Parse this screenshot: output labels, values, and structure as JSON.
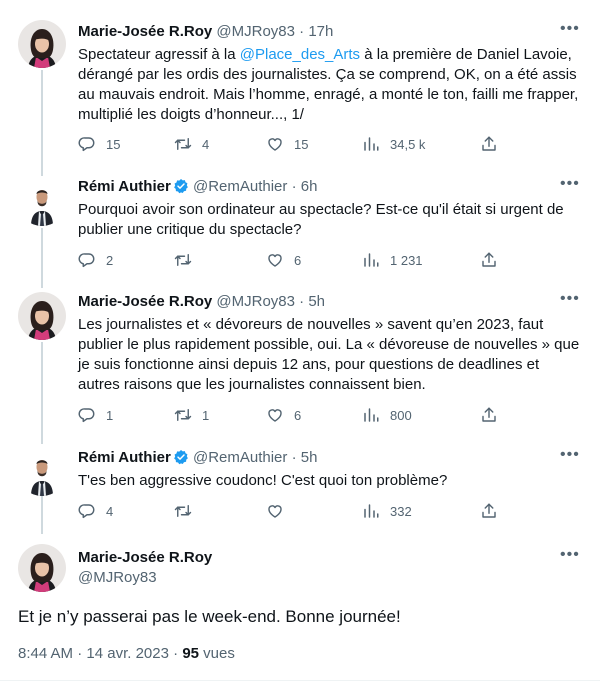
{
  "tweets": [
    {
      "name": "Marie-Josée R.Roy",
      "handle": "@MJRoy83",
      "time": "17h",
      "text_before": "Spectateur agressif à la ",
      "mention": "@Place_des_Arts",
      "text_after": " à la première de Daniel Lavoie, dérangé par les ordis des journalistes. Ça se comprend, OK, on a été assis au mauvais endroit. Mais l’homme, enragé, a monté le ton, failli me frapper, multiplié les doigts d’honneur..., 1/",
      "replies": "15",
      "retweets": "4",
      "likes": "15",
      "views": "34,5 k"
    },
    {
      "name": "Rémi Authier",
      "handle": "@RemAuthier",
      "time": "6h",
      "text": "Pourquoi avoir son ordinateur au spectacle? Est-ce qu'il était si urgent de publier une critique du spectacle?",
      "replies": "2",
      "retweets": "",
      "likes": "6",
      "views": "1 231"
    },
    {
      "name": "Marie-Josée R.Roy",
      "handle": "@MJRoy83",
      "time": "5h",
      "text": "Les journalistes et « dévoreurs de nouvelles » savent qu’en 2023, faut publier le plus rapidement possible, oui. La « dévoreuse de nouvelles » que je suis fonctionne ainsi depuis 12 ans, pour questions de deadlines et autres raisons que les journalistes connaissent bien.",
      "replies": "1",
      "retweets": "1",
      "likes": "6",
      "views": "800"
    },
    {
      "name": "Rémi Authier",
      "handle": "@RemAuthier",
      "time": "5h",
      "text": "T'es ben aggressive coudonc! C'est quoi ton problème?",
      "replies": "4",
      "retweets": "",
      "likes": "",
      "views": "332"
    }
  ],
  "main": {
    "name": "Marie-Josée R.Roy",
    "handle": "@MJRoy83",
    "text": "Et je n’y passerai pas le week-end. Bonne journée!",
    "time": "8:44 AM",
    "date": "14 avr. 2023",
    "views_count": "95",
    "views_label": "vues"
  },
  "separator": "·",
  "colors": {
    "accent": "#1d9bf0",
    "secondary": "#536471",
    "text": "#0f1419",
    "line": "#cfd9de"
  }
}
